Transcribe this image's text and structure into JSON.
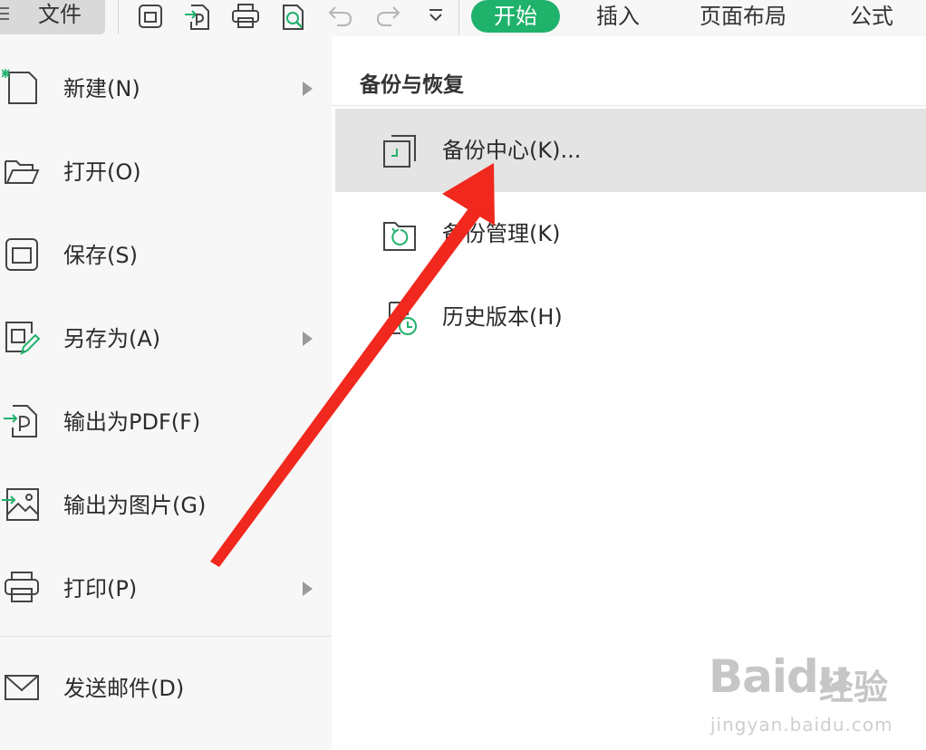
{
  "toolbar": {
    "file_label": "文件",
    "quick_icons": [
      "save-icon",
      "export-pdf-icon",
      "print-icon",
      "print-preview-icon",
      "undo-icon",
      "redo-icon",
      "more-dropdown-icon"
    ],
    "tabs": [
      {
        "label": "开始",
        "active": true
      },
      {
        "label": "插入",
        "active": false
      },
      {
        "label": "页面布局",
        "active": false
      },
      {
        "label": "公式",
        "active": false
      }
    ],
    "accent_color": "#1fb26b"
  },
  "file_menu": {
    "items": [
      {
        "label": "新建(N)",
        "icon": "new-document-icon",
        "submenu": true
      },
      {
        "label": "打开(O)",
        "icon": "folder-open-icon",
        "submenu": false
      },
      {
        "label": "保存(S)",
        "icon": "save-icon",
        "submenu": false
      },
      {
        "label": "另存为(A)",
        "icon": "save-as-icon",
        "submenu": true
      },
      {
        "label": "输出为PDF(F)",
        "icon": "export-pdf-icon",
        "submenu": false
      },
      {
        "label": "输出为图片(G)",
        "icon": "export-image-icon",
        "submenu": false
      },
      {
        "label": "打印(P)",
        "icon": "print-icon",
        "submenu": true
      },
      {
        "label": "发送邮件(D)",
        "icon": "mail-icon",
        "submenu": false
      }
    ]
  },
  "backup_panel": {
    "title": "备份与恢复",
    "items": [
      {
        "label": "备份中心(K)...",
        "icon": "backup-center-icon",
        "selected": true
      },
      {
        "label": "备份管理(K)",
        "icon": "backup-manage-icon",
        "selected": false
      },
      {
        "label": "历史版本(H)",
        "icon": "history-version-icon",
        "selected": false
      }
    ]
  },
  "annotation": {
    "color": "#f0281e"
  },
  "watermark": {
    "brand": "Baidu",
    "suffix": "经验",
    "url": "jingyan.baidu.com"
  }
}
